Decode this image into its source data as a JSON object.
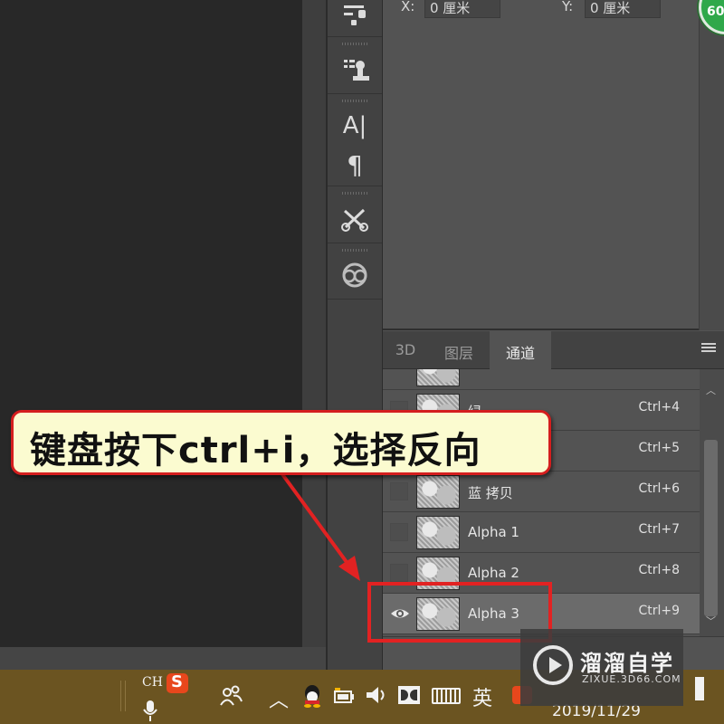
{
  "properties": {
    "x_label": "X:",
    "x_value": "0 厘米",
    "y_label": "Y:",
    "y_value": "0 厘米",
    "badge_text": "60"
  },
  "panel": {
    "tabs": [
      {
        "label": "3D"
      },
      {
        "label": "图层"
      },
      {
        "label": "通道"
      }
    ],
    "active_tab": "通道"
  },
  "channels": [
    {
      "name": "",
      "shortcut": "",
      "visible": false
    },
    {
      "name": "绿",
      "shortcut": "Ctrl+4",
      "visible": false
    },
    {
      "name": "",
      "shortcut": "Ctrl+5",
      "visible": false
    },
    {
      "name": "蓝 拷贝",
      "shortcut": "Ctrl+6",
      "visible": false
    },
    {
      "name": "Alpha 1",
      "shortcut": "Ctrl+7",
      "visible": false
    },
    {
      "name": "Alpha 2",
      "shortcut": "Ctrl+8",
      "visible": false
    },
    {
      "name": "Alpha 3",
      "shortcut": "Ctrl+9",
      "visible": true,
      "selected": true
    }
  ],
  "callout": {
    "text": "键盘按下ctrl+i，选择反向"
  },
  "taskbar": {
    "lang": "CH",
    "ime": "英",
    "clock": "2019/11/29"
  },
  "watermark": {
    "title": "溜溜自学",
    "subtitle": "ZIXUE.3D66.COM"
  },
  "colors": {
    "highlight": "#e22222",
    "callout_bg": "#fbfbd0",
    "taskbar": "#6b5421",
    "badge": "#2fa84a"
  }
}
